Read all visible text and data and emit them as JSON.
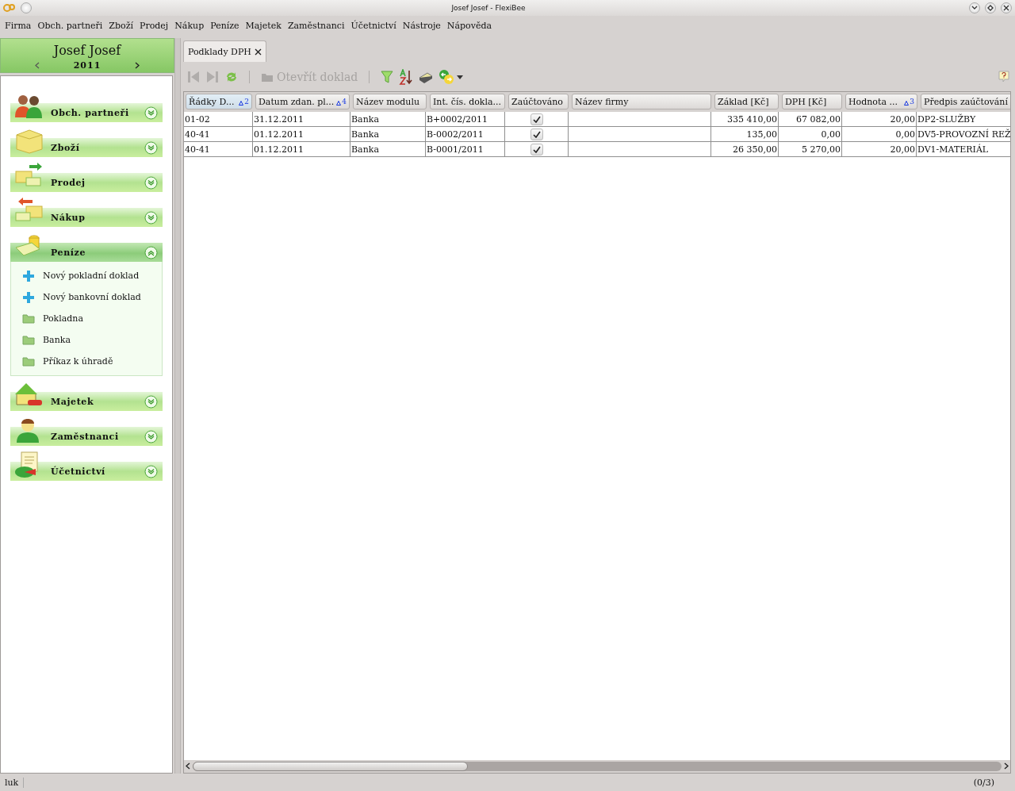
{
  "window": {
    "title": "Josef Josef - FlexiBee"
  },
  "menu": [
    "Firma",
    "Obch. partneři",
    "Zboží",
    "Prodej",
    "Nákup",
    "Peníze",
    "Majetek",
    "Zaměstnanci",
    "Účetnictví",
    "Nástroje",
    "Nápověda"
  ],
  "company": {
    "name": "Josef Josef",
    "year": "2011"
  },
  "sidebar": {
    "sections": [
      {
        "label": "Obch. partneři",
        "expanded": false
      },
      {
        "label": "Zboží",
        "expanded": false
      },
      {
        "label": "Prodej",
        "expanded": false
      },
      {
        "label": "Nákup",
        "expanded": false
      },
      {
        "label": "Peníze",
        "expanded": true,
        "items": [
          {
            "label": "Nový pokladní doklad",
            "kind": "new"
          },
          {
            "label": "Nový bankovní doklad",
            "kind": "new"
          },
          {
            "label": "Pokladna",
            "kind": "folder"
          },
          {
            "label": "Banka",
            "kind": "folder"
          },
          {
            "label": "Příkaz k úhradě",
            "kind": "folder"
          }
        ]
      },
      {
        "label": "Majetek",
        "expanded": false
      },
      {
        "label": "Zaměstnanci",
        "expanded": false
      },
      {
        "label": "Účetnictví",
        "expanded": false
      }
    ]
  },
  "tabs": [
    {
      "label": "Podklady DPH",
      "selected": true
    }
  ],
  "toolbar": {
    "open_button": {
      "label": "Otevřít doklad",
      "disabled": true
    }
  },
  "table": {
    "columns": [
      {
        "label": "Řádky D...",
        "sort": "2",
        "kind": "text",
        "selected": true
      },
      {
        "label": "Datum zdan. pl...",
        "sort": "4",
        "kind": "text",
        "selected": false
      },
      {
        "label": "Název modulu",
        "kind": "text",
        "selected": false
      },
      {
        "label": "Int. čís. dokla...",
        "kind": "text",
        "selected": false
      },
      {
        "label": "Zaúčtováno",
        "kind": "check",
        "selected": false
      },
      {
        "label": "Název firmy",
        "kind": "text",
        "selected": false
      },
      {
        "label": "Základ [Kč]",
        "kind": "number",
        "selected": false
      },
      {
        "label": "DPH [Kč]",
        "kind": "number",
        "selected": false
      },
      {
        "label": "Hodnota ...",
        "sort": "3",
        "kind": "number",
        "selected": false
      },
      {
        "label": "Předpis zaúčtování",
        "kind": "text",
        "selected": false
      }
    ],
    "rows": [
      {
        "cells": [
          "01-02",
          "31.12.2011",
          "Banka",
          "B+0002/2011",
          {
            "checked": true
          },
          null,
          "335 410,00",
          "67 082,00",
          "20,00",
          "DP2-SLUŽBY"
        ]
      },
      {
        "cells": [
          "40-41",
          "01.12.2011",
          "Banka",
          "B-0002/2011",
          {
            "checked": true
          },
          null,
          "135,00",
          "0,00",
          "0,00",
          "DV5-PROVOZNÍ REŽ"
        ]
      },
      {
        "cells": [
          "40-41",
          "01.12.2011",
          "Banka",
          "B-0001/2011",
          {
            "checked": true
          },
          null,
          "26 350,00",
          "5 270,00",
          "20,00",
          "DV1-MATERIÁL"
        ]
      }
    ]
  },
  "status_bar": {
    "user": "luk",
    "count": "(0/3)"
  }
}
